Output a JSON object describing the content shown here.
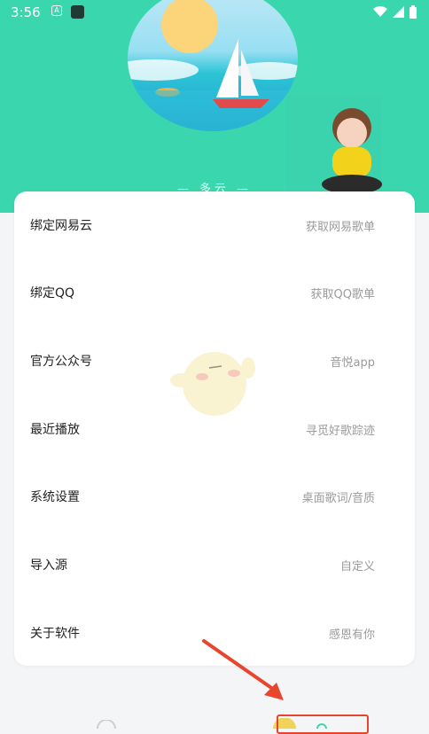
{
  "status_bar": {
    "time": "3:56",
    "icons": [
      "notification-a-icon",
      "app-icon",
      "wifi-icon",
      "signal-icon",
      "battery-icon"
    ]
  },
  "header": {
    "weather": "— 多云 —",
    "accent_color": "#3ad7ae"
  },
  "menu": [
    {
      "label": "绑定网易云",
      "value": "获取网易歌单"
    },
    {
      "label": "绑定QQ",
      "value": "获取QQ歌单"
    },
    {
      "label": "官方公众号",
      "value": "音悦app"
    },
    {
      "label": "最近播放",
      "value": "寻觅好歌踪迹"
    },
    {
      "label": "系统设置",
      "value": "桌面歌词/音质"
    },
    {
      "label": "导入源",
      "value": "自定义"
    },
    {
      "label": "关于软件",
      "value": "感恩有你"
    }
  ],
  "annotation": {
    "arrow_color": "#e8452e"
  }
}
